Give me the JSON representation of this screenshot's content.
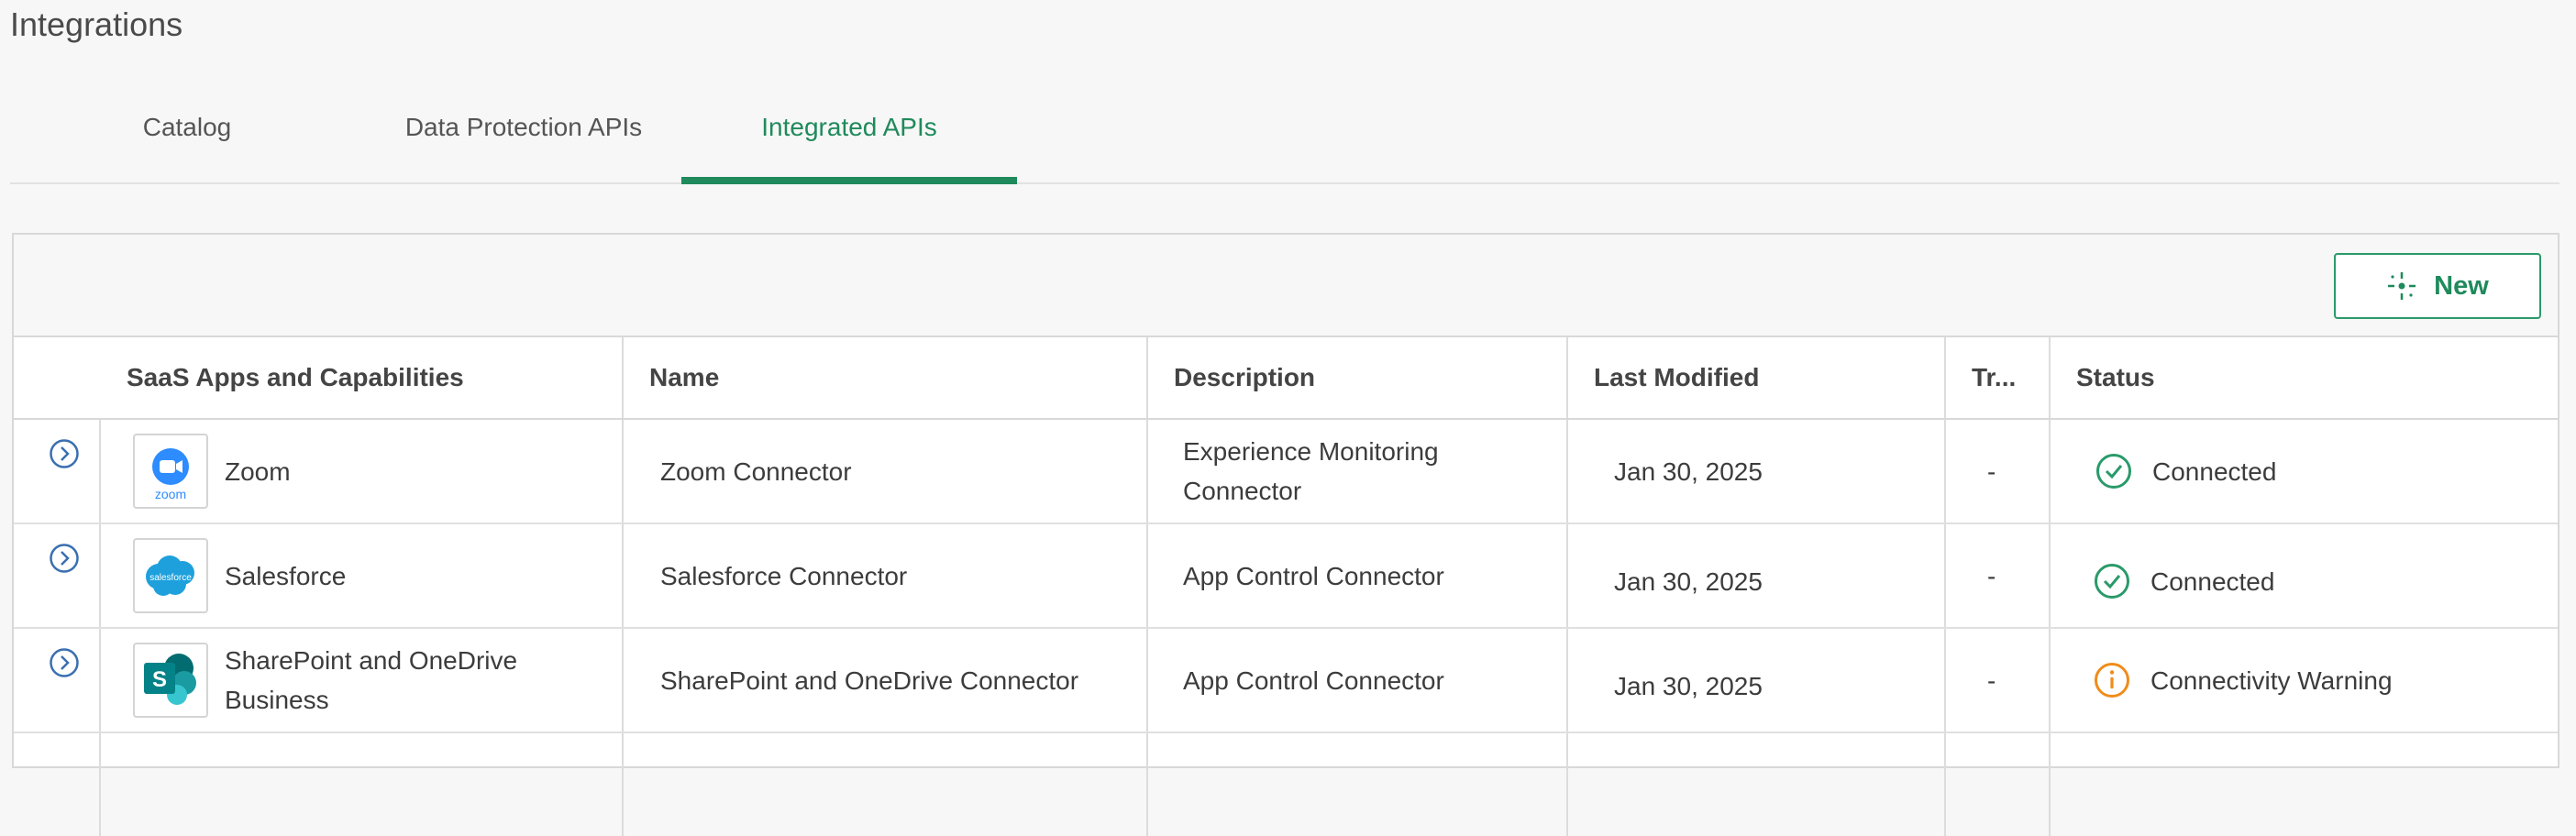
{
  "page": {
    "title": "Integrations"
  },
  "tabs": [
    {
      "label": "Catalog"
    },
    {
      "label": "Data Protection APIs"
    },
    {
      "label": "Integrated APIs"
    }
  ],
  "toolbar": {
    "new_label": "New"
  },
  "table": {
    "columns": [
      "SaaS Apps and Capabilities",
      "Name",
      "Description",
      "Last Modified",
      "Tr...",
      "Status"
    ],
    "rows": [
      {
        "app": "Zoom",
        "logo_text": "zoom",
        "name": "Zoom Connector",
        "description": "Experience Monitoring Connector",
        "modified": "Jan 30, 2025",
        "tr": "-",
        "status": "Connected",
        "status_type": "ok"
      },
      {
        "app": "Salesforce",
        "logo_text": "salesforce",
        "name": "Salesforce Connector",
        "description": "App Control Connector",
        "modified": "Jan 30, 2025",
        "tr": "-",
        "status": "Connected",
        "status_type": "ok"
      },
      {
        "app": "SharePoint and OneDrive Business",
        "logo_text": "S",
        "name": "SharePoint and OneDrive Connector",
        "description": "App Control Connector",
        "modified": "Jan 30, 2025",
        "tr": "-",
        "status": "Connectivity Warning",
        "status_type": "warning"
      }
    ]
  },
  "colors": {
    "accent": "#1f8a5b",
    "ok": "#2a9a6a",
    "warning": "#f08c1a",
    "expander": "#3a6fb0"
  }
}
